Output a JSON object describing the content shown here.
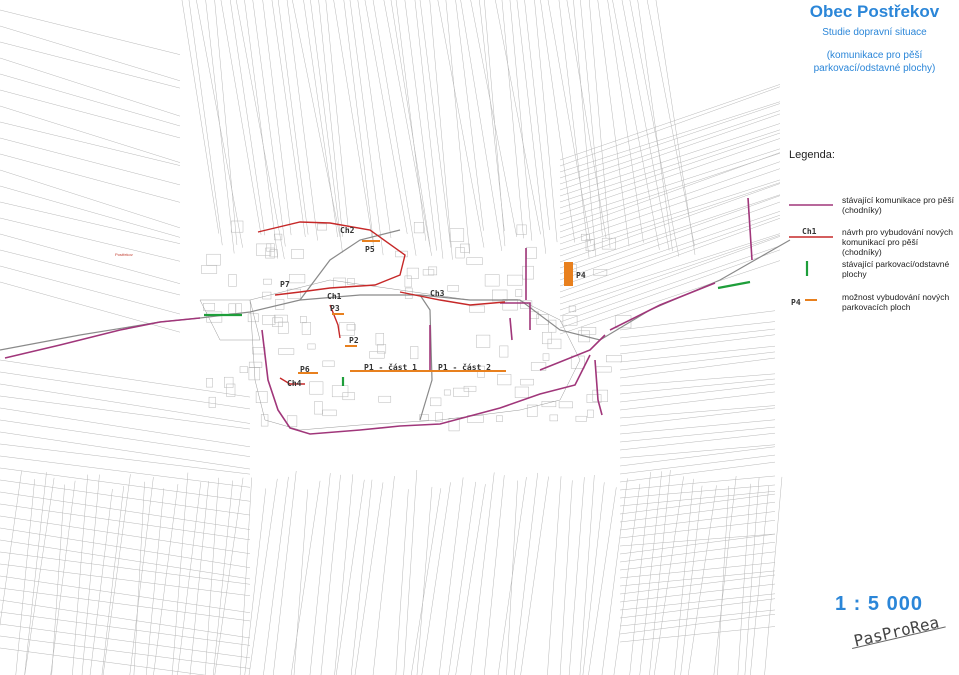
{
  "header": {
    "title": "Obec Postřekov",
    "subtitle": "Studie dopravní situace",
    "subtitle_detail": "(komunikace pro pěší parkovací/odstavné plochy)"
  },
  "legend": {
    "heading": "Legenda:",
    "items": [
      {
        "symbol": "purple-line",
        "label": "stávající komunikace pro pěší (chodníky)",
        "color": "#a0367a"
      },
      {
        "symbol": "red-line",
        "code": "Ch1",
        "label": "návrh pro vybudování nových komunikací pro pěší (chodníky)",
        "color": "#c62828"
      },
      {
        "symbol": "green-bar",
        "label": "stávající parkovací/odstavné plochy",
        "color": "#1e9e3a"
      },
      {
        "symbol": "orange-bar",
        "code": "P4",
        "label": "možnost vybudování nových parkovacích ploch",
        "color": "#e8801e"
      }
    ]
  },
  "map_labels": {
    "ch1": "Ch1",
    "ch2": "Ch2",
    "ch3": "Ch3",
    "ch4": "Ch4",
    "p1a": "P1 - část 1",
    "p1b": "P1 - část 2",
    "p2": "P2",
    "p3": "P3",
    "p4": "P4",
    "p5": "P5",
    "p6": "P6",
    "p7": "P7"
  },
  "place_names": {
    "postrekov": "Postřekov"
  },
  "scale": "1 : 5 000",
  "logo": "PasProRea",
  "colors": {
    "title_blue": "#2b86d8",
    "existing_walkway": "#a0367a",
    "proposed_walkway": "#c62828",
    "existing_parking": "#1e9e3a",
    "proposed_parking": "#e8801e"
  }
}
